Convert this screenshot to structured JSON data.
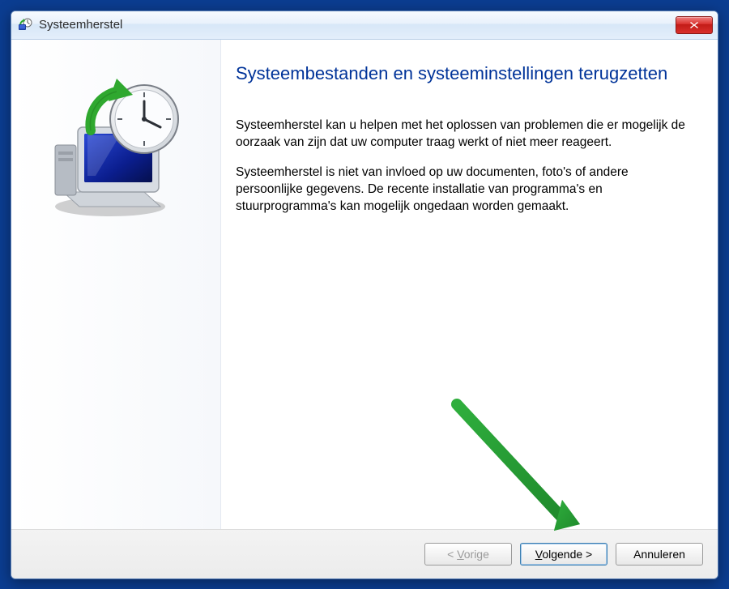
{
  "window": {
    "title": "Systeemherstel"
  },
  "content": {
    "heading": "Systeembestanden en systeeminstellingen terugzetten",
    "paragraph1": "Systeemherstel kan u helpen met het oplossen van problemen die er mogelijk de oorzaak van zijn dat uw computer traag werkt of niet meer reageert.",
    "paragraph2": "Systeemherstel is niet van invloed op uw documenten, foto's of andere persoonlijke gegevens. De recente installatie van programma's en stuurprogramma's kan mogelijk ongedaan worden gemaakt."
  },
  "buttons": {
    "back_prefix": "< ",
    "back_letter": "V",
    "back_rest": "orige",
    "next_letter": "V",
    "next_rest": "olgende >",
    "cancel": "Annuleren"
  }
}
